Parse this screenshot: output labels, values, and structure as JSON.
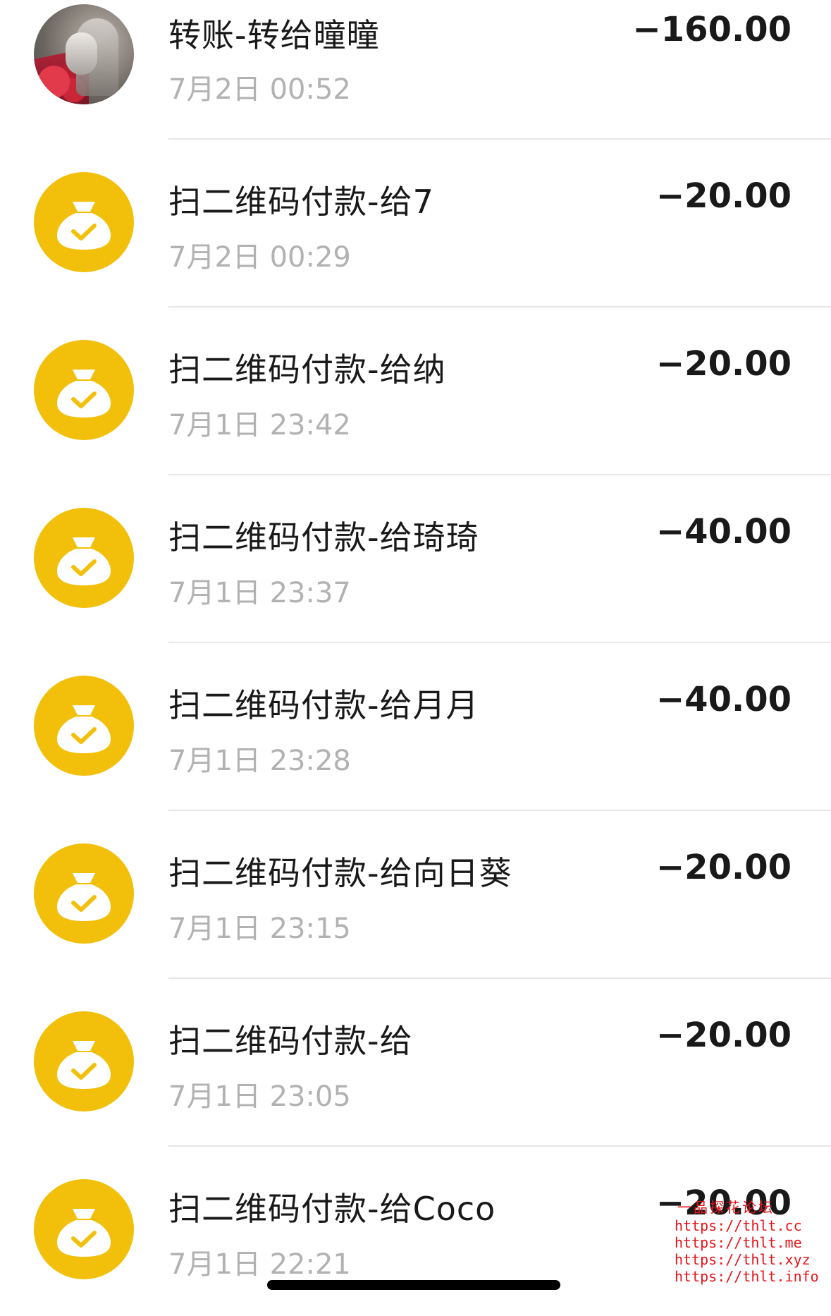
{
  "colors": {
    "accent": "#f2c00a",
    "title_text": "#191919",
    "time_text": "#b2b2b2",
    "watermark": "#e8141a"
  },
  "transactions": [
    {
      "icon": "contact-avatar-photo",
      "title": "转账-转给曈曈",
      "time": "7月2日 00:52",
      "amount": "−160.00"
    },
    {
      "icon": "money-bag-check-icon",
      "title": "扫二维码付款-给7",
      "time": "7月2日 00:29",
      "amount": "−20.00"
    },
    {
      "icon": "money-bag-check-icon",
      "title": "扫二维码付款-给纳",
      "time": "7月1日 23:42",
      "amount": "−20.00"
    },
    {
      "icon": "money-bag-check-icon",
      "title": "扫二维码付款-给琦琦",
      "time": "7月1日 23:37",
      "amount": "−40.00"
    },
    {
      "icon": "money-bag-check-icon",
      "title": "扫二维码付款-给月月",
      "time": "7月1日 23:28",
      "amount": "−40.00"
    },
    {
      "icon": "money-bag-check-icon",
      "title": "扫二维码付款-给向日葵",
      "time": "7月1日 23:15",
      "amount": "−20.00"
    },
    {
      "icon": "money-bag-check-icon",
      "title": "扫二维码付款-给",
      "time": "7月1日 23:05",
      "amount": "−20.00"
    },
    {
      "icon": "money-bag-check-icon",
      "title": "扫二维码付款-给Coco",
      "time": "7月1日 22:21",
      "amount": "−20.00"
    }
  ],
  "watermark": {
    "brand": "一品探花论坛",
    "links": [
      "https://thlt.cc",
      "https://thlt.me",
      "https://thlt.xyz",
      "https://thlt.info"
    ]
  }
}
